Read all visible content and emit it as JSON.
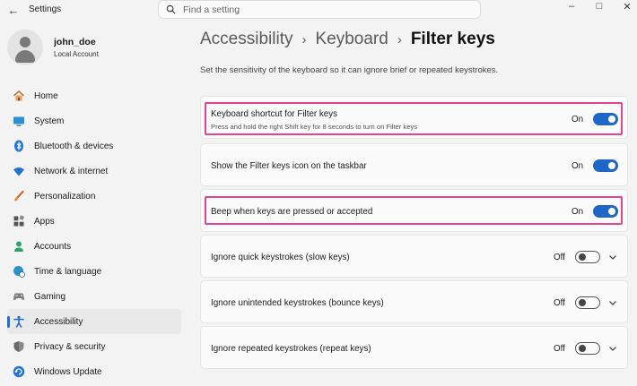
{
  "window": {
    "app_title": "Settings",
    "controls": {
      "minimize": "–",
      "maximize": "□",
      "close": "✕"
    }
  },
  "search": {
    "placeholder": "Find a setting"
  },
  "profile": {
    "name": "john_doe",
    "account_type": "Local Account"
  },
  "sidebar": {
    "items": [
      {
        "label": "Home",
        "icon": "home-icon",
        "active": false
      },
      {
        "label": "System",
        "icon": "monitor-icon",
        "active": false
      },
      {
        "label": "Bluetooth & devices",
        "icon": "bluetooth-icon",
        "active": false
      },
      {
        "label": "Network & internet",
        "icon": "wifi-icon",
        "active": false
      },
      {
        "label": "Personalization",
        "icon": "brush-icon",
        "active": false
      },
      {
        "label": "Apps",
        "icon": "apps-icon",
        "active": false
      },
      {
        "label": "Accounts",
        "icon": "person-icon",
        "active": false
      },
      {
        "label": "Time & language",
        "icon": "globe-clock-icon",
        "active": false
      },
      {
        "label": "Gaming",
        "icon": "gamepad-icon",
        "active": false
      },
      {
        "label": "Accessibility",
        "icon": "accessibility-icon",
        "active": true
      },
      {
        "label": "Privacy & security",
        "icon": "shield-icon",
        "active": false
      },
      {
        "label": "Windows Update",
        "icon": "update-icon",
        "active": false
      }
    ]
  },
  "breadcrumb": {
    "level1": "Accessibility",
    "level2": "Keyboard",
    "current": "Filter keys",
    "separator": "›"
  },
  "page": {
    "description": "Set the sensitivity of the keyboard so it can ignore brief or repeated keystrokes."
  },
  "settings": [
    {
      "title": "Keyboard shortcut for Filter keys",
      "subtitle": "Press and hold the right Shift key for 8 seconds to turn on Filter keys",
      "state": "On",
      "on": true,
      "expandable": false,
      "highlighted": true
    },
    {
      "title": "Show the Filter keys icon on the taskbar",
      "subtitle": "",
      "state": "On",
      "on": true,
      "expandable": false,
      "highlighted": false
    },
    {
      "title": "Beep when keys are pressed or accepted",
      "subtitle": "",
      "state": "On",
      "on": true,
      "expandable": false,
      "highlighted": true
    },
    {
      "title": "Ignore quick keystrokes (slow keys)",
      "subtitle": "",
      "state": "Off",
      "on": false,
      "expandable": true,
      "highlighted": false
    },
    {
      "title": "Ignore unintended keystrokes (bounce keys)",
      "subtitle": "",
      "state": "Off",
      "on": false,
      "expandable": true,
      "highlighted": false
    },
    {
      "title": "Ignore repeated keystrokes (repeat keys)",
      "subtitle": "",
      "state": "Off",
      "on": false,
      "expandable": true,
      "highlighted": false
    }
  ],
  "colors": {
    "accent": "#1f67c7",
    "highlight": "#e0458d",
    "background": "#f3f3f3",
    "card": "#fbfbfb"
  }
}
